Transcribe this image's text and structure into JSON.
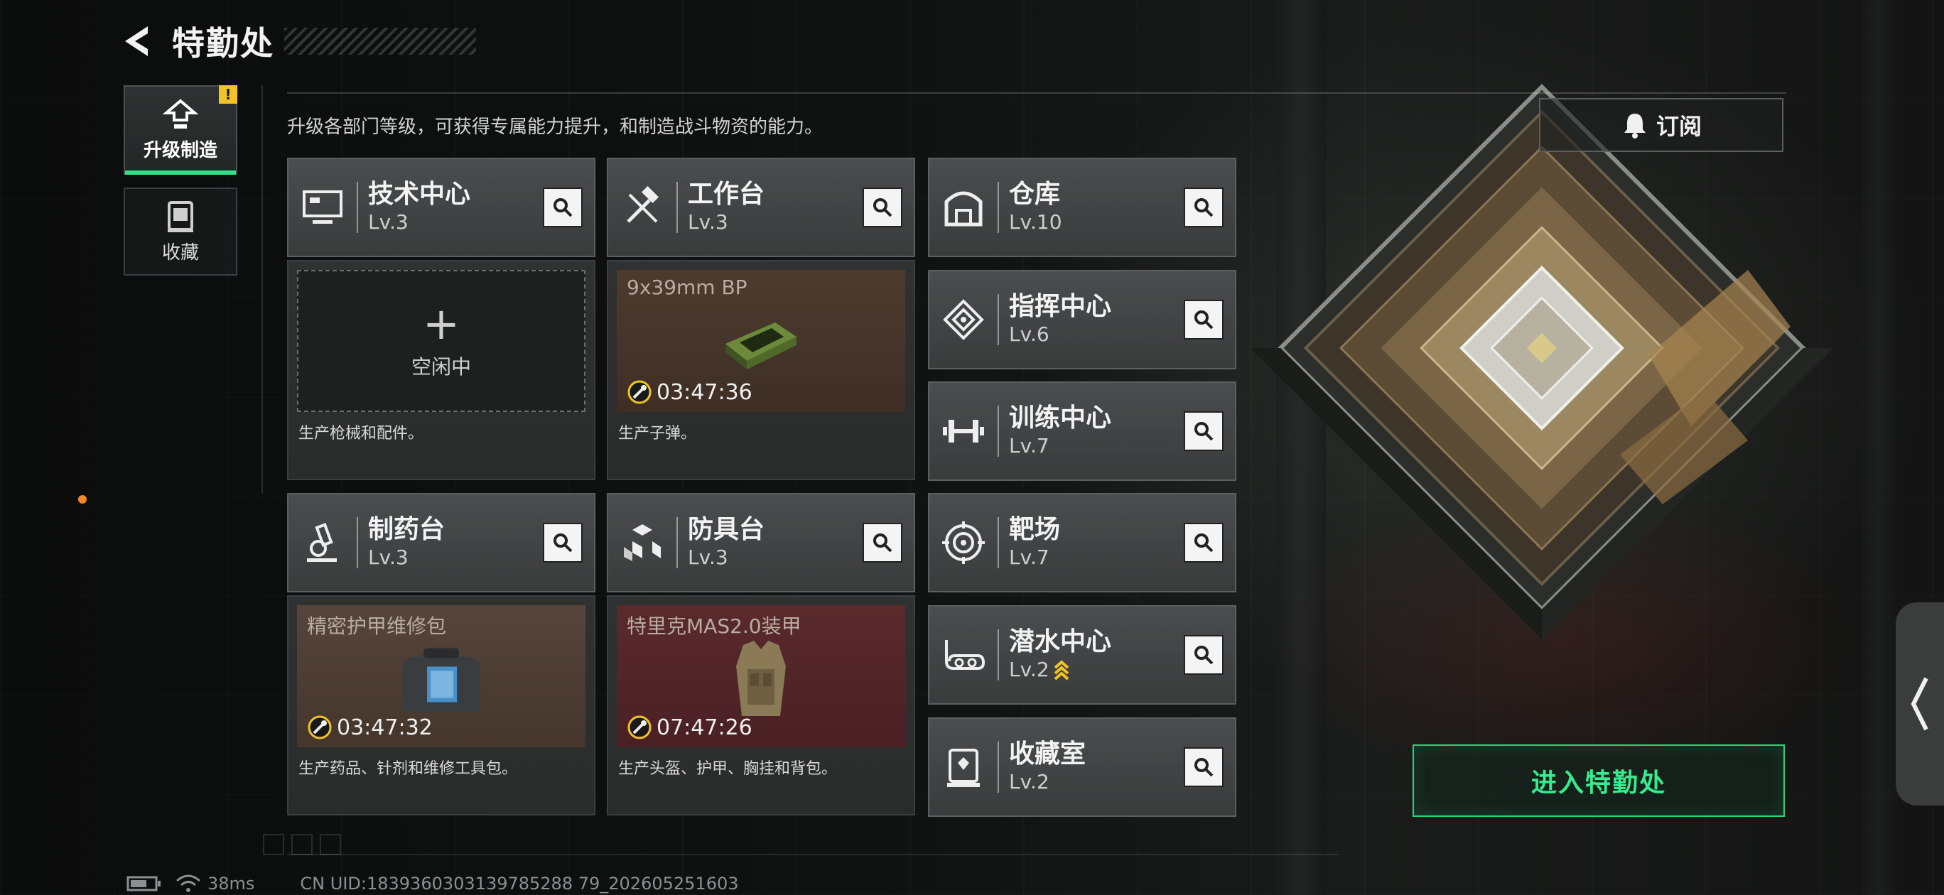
{
  "header": {
    "title": "特勤处",
    "back_icon": "back-arrow-icon"
  },
  "nav": {
    "items": [
      {
        "label": "升级制造",
        "icon": "upgrade-icon",
        "active": true,
        "badge": "!"
      },
      {
        "label": "收藏",
        "icon": "collection-icon",
        "active": false
      }
    ]
  },
  "description": "升级各部门等级，可获得专属能力提升，和制造战斗物资的能力。",
  "subscribe": {
    "label": "订阅",
    "icon": "bell-icon"
  },
  "workshops": [
    {
      "name": "技术中心",
      "level": "Lv.3",
      "icon": "monitor-icon",
      "slot": {
        "state": "idle",
        "idle_label": "空闲中"
      },
      "footer": "生产枪械和配件。"
    },
    {
      "name": "工作台",
      "level": "Lv.3",
      "icon": "hammer-icon",
      "slot": {
        "state": "producing",
        "item": "9x39mm BP",
        "timer": "03:47:36",
        "color": "#4d3b2f"
      },
      "footer": "生产子弹。"
    },
    {
      "name": "制药台",
      "level": "Lv.3",
      "icon": "microscope-icon",
      "slot": {
        "state": "producing",
        "item": "精密护甲维修包",
        "timer": "03:47:32",
        "color": "#55453a"
      },
      "footer": "生产药品、针剂和维修工具包。"
    },
    {
      "name": "防具台",
      "level": "Lv.3",
      "icon": "cubes-icon",
      "slot": {
        "state": "producing",
        "item": "特里克MAS2.0装甲",
        "timer": "07:47:26",
        "color": "#5a2a2d"
      },
      "footer": "生产头盔、护甲、胸挂和背包。"
    }
  ],
  "facilities": [
    {
      "name": "仓库",
      "level": "Lv.10",
      "icon": "warehouse-icon"
    },
    {
      "name": "指挥中心",
      "level": "Lv.6",
      "icon": "command-icon"
    },
    {
      "name": "训练中心",
      "level": "Lv.7",
      "icon": "dumbbell-icon"
    },
    {
      "name": "靶场",
      "level": "Lv.7",
      "icon": "target-icon"
    },
    {
      "name": "潜水中心",
      "level": "Lv.2",
      "icon": "diving-mask-icon",
      "upgradable": true
    },
    {
      "name": "收藏室",
      "level": "Lv.2",
      "icon": "display-case-icon"
    }
  ],
  "enter_button": {
    "label": "进入特勤处"
  },
  "status": {
    "ping": "38ms",
    "uid": "CN UID:1839360303139785288 79_202605251603"
  },
  "colors": {
    "accent": "#2ee38a",
    "warning": "#f3c325",
    "timer_ring": "#f3c325"
  }
}
